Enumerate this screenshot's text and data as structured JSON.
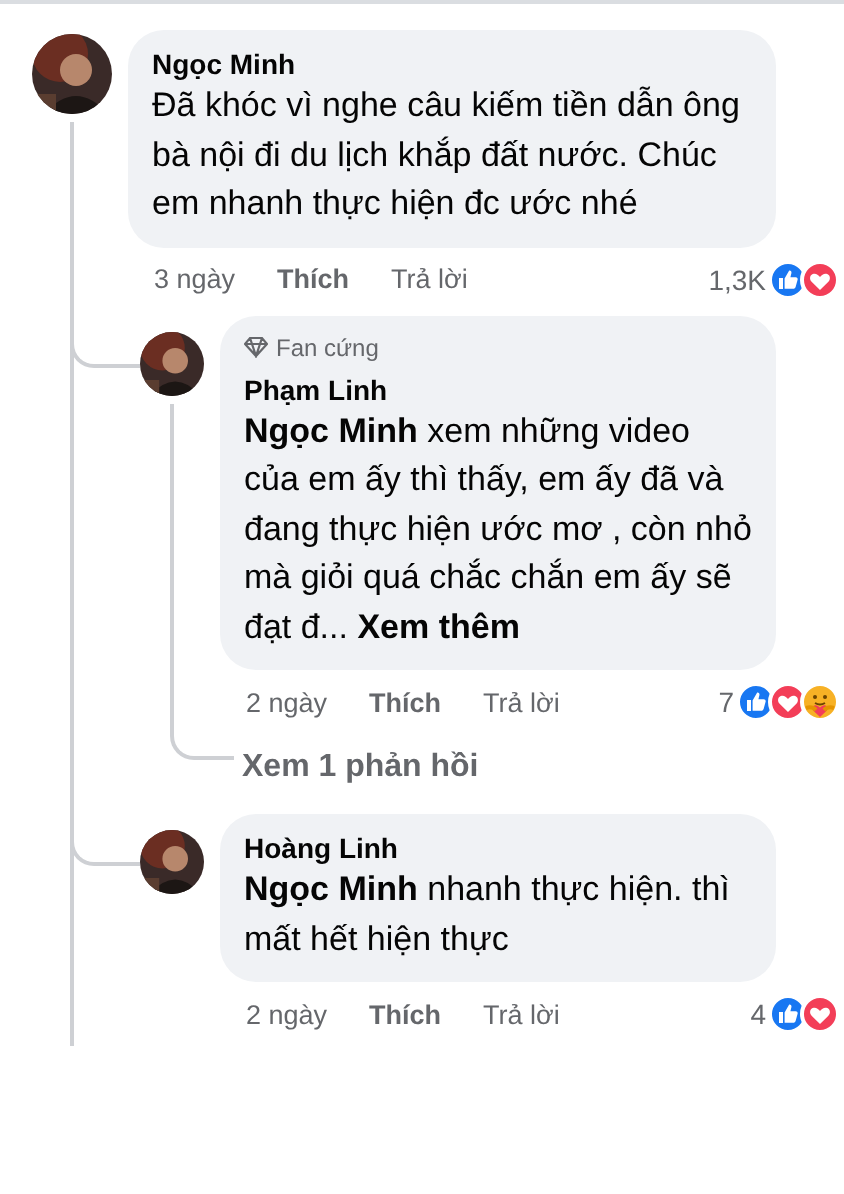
{
  "comments": [
    {
      "author": "Ngọc Minh",
      "text": "Đã khóc vì nghe câu kiếm tiền dẫn ông bà nội đi du lịch khắp đất nước. Chúc em nhanh thực hiện đc ước nhé",
      "time": "3 ngày",
      "like_label": "Thích",
      "reply_label": "Trả lời",
      "reaction_count": "1,3K",
      "reactions": [
        {
          "kind": "like"
        },
        {
          "kind": "love"
        }
      ],
      "replies": [
        {
          "badge": "Fan cứng",
          "author": "Phạm Linh",
          "text": "**Ngọc Minh** xem những video của em ấy thì thấy, em ấy đã và đang thực hiện ước mơ , còn nhỏ mà giỏi quá chắc chắn em ấy sẽ đạt đ...",
          "see_more": "Xem thêm",
          "time": "2 ngày",
          "like_label": "Thích",
          "reply_label": "Trả lời",
          "reaction_count": "7",
          "reactions": [
            {
              "kind": "like"
            },
            {
              "kind": "love"
            },
            {
              "kind": "care"
            }
          ],
          "more_replies": "Xem 1 phản hồi"
        },
        {
          "author": "Hoàng Linh",
          "text": "**Ngọc Minh** nhanh thực hiện. thì mất hết hiện thực",
          "time": "2 ngày",
          "like_label": "Thích",
          "reply_label": "Trả lời",
          "reaction_count": "4",
          "reactions": [
            {
              "kind": "like"
            },
            {
              "kind": "love"
            }
          ]
        }
      ]
    }
  ]
}
